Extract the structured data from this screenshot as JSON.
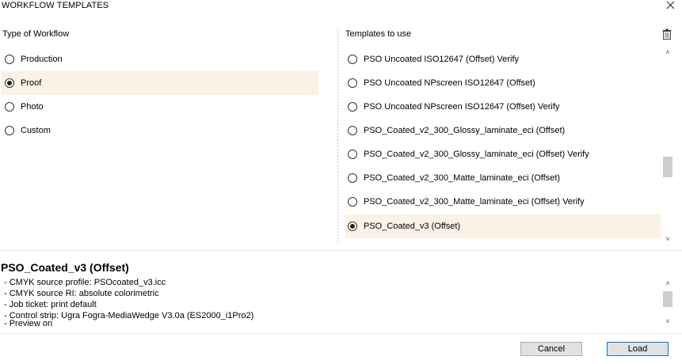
{
  "window": {
    "title": "WORKFLOW TEMPLATES"
  },
  "workflow": {
    "label": "Type of Workflow",
    "options": [
      {
        "label": "Production",
        "checked": false
      },
      {
        "label": "Proof",
        "checked": true
      },
      {
        "label": "Photo",
        "checked": false
      },
      {
        "label": "Custom",
        "checked": false
      }
    ]
  },
  "templates": {
    "label": "Templates to use",
    "items": [
      {
        "label": "PSO Uncoated ISO12647 (Offset) Verify",
        "checked": false
      },
      {
        "label": "PSO Uncoated NPscreen ISO12647 (Offset)",
        "checked": false
      },
      {
        "label": "PSO Uncoated NPscreen ISO12647 (Offset) Verify",
        "checked": false
      },
      {
        "label": "PSO_Coated_v2_300_Glossy_laminate_eci (Offset)",
        "checked": false
      },
      {
        "label": "PSO_Coated_v2_300_Glossy_laminate_eci (Offset) Verify",
        "checked": false
      },
      {
        "label": "PSO_Coated_v2_300_Matte_laminate_eci (Offset)",
        "checked": false
      },
      {
        "label": "PSO_Coated_v2_300_Matte_laminate_eci (Offset) Verify",
        "checked": false
      },
      {
        "label": "PSO_Coated_v3 (Offset)",
        "checked": true
      }
    ]
  },
  "description": {
    "title": "PSO_Coated_v3 (Offset)",
    "lines": [
      "- CMYK source profile: PSOcoated_v3.icc",
      "- CMYK source RI: absolute colorimetric",
      "- Job ticket: print default",
      "- Control strip: Ugra Fogra-MediaWedge V3.0a (ES2000_i1Pro2)",
      "- Preview on"
    ]
  },
  "buttons": {
    "cancel": "Cancel",
    "load": "Load"
  },
  "colors": {
    "selected_row": "#fbf1e5",
    "accent_border": "#0078d7"
  }
}
